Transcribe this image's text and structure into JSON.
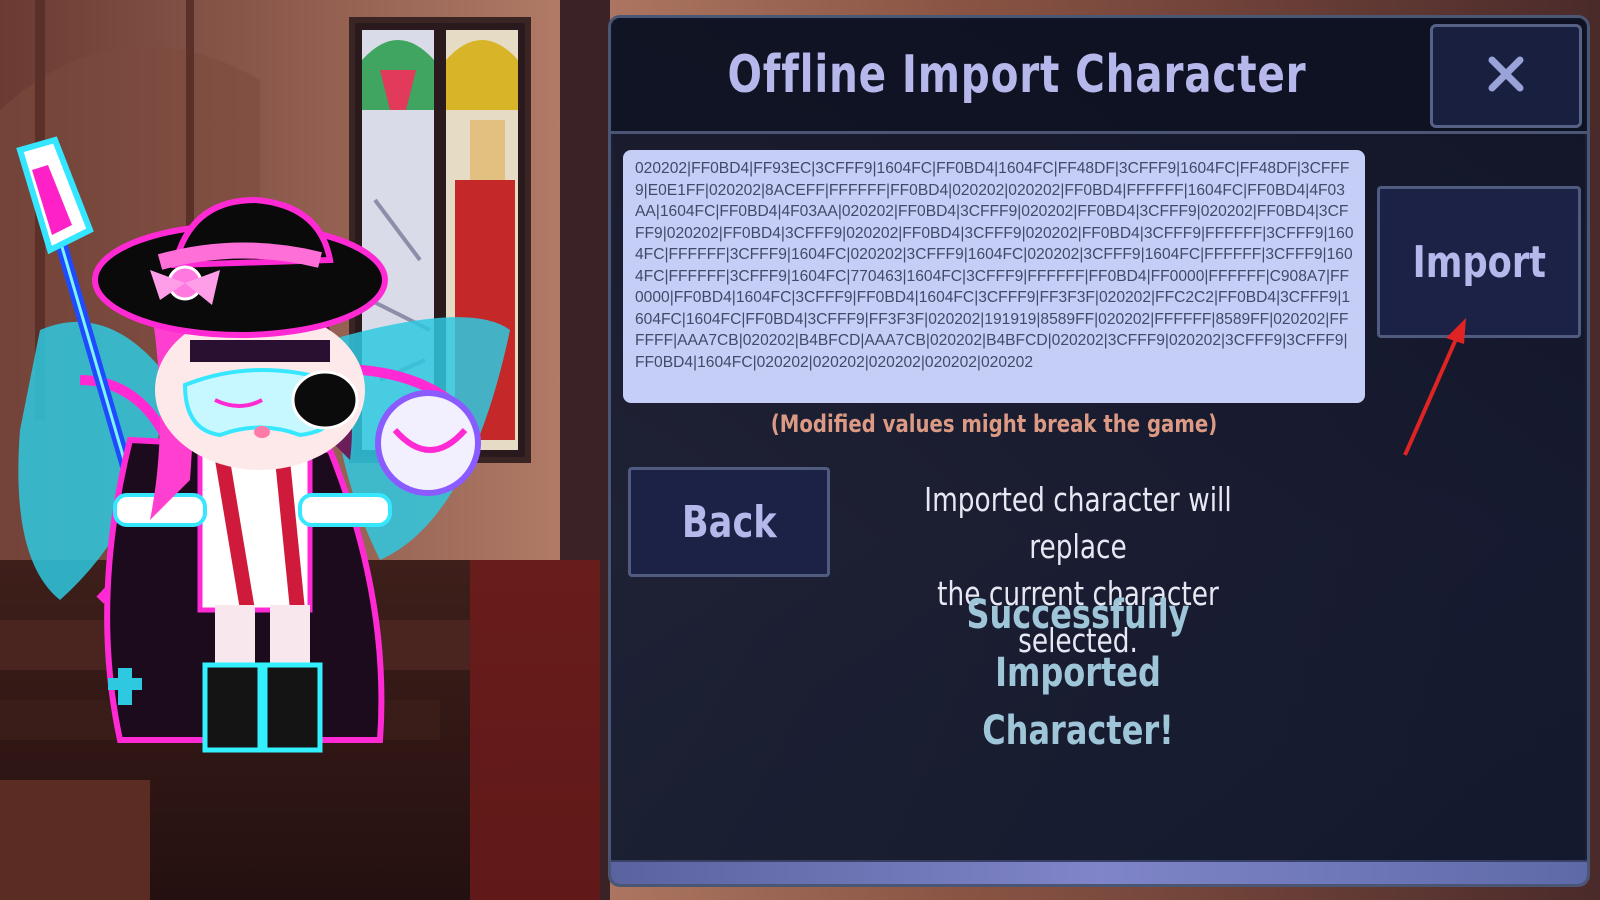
{
  "dialog": {
    "title": "Offline Import Character",
    "close_glyph": "X",
    "code_value": "020202|FF0BD4|FF93EC|3CFFF9|1604FC|FF0BD4|1604FC|FF48DF|3CFFF9|1604FC|FF48DF|3CFFF9|E0E1FF|020202|8ACEFF|FFFFFF|FF0BD4|020202|020202|FF0BD4|FFFFFF|1604FC|FF0BD4|4F03AA|1604FC|FF0BD4|4F03AA|020202|FF0BD4|3CFFF9|020202|FF0BD4|3CFFF9|020202|FF0BD4|3CFFF9|020202|FF0BD4|3CFFF9|020202|FF0BD4|3CFFF9|020202|FF0BD4|3CFFF9|FFFFFF|3CFFF9|1604FC|FFFFFF|3CFFF9|1604FC|020202|3CFFF9|1604FC|020202|3CFFF9|1604FC|FFFFFF|3CFFF9|1604FC|FFFFFF|3CFFF9|1604FC|770463|1604FC|3CFFF9|FFFFFF|FF0BD4|FF0000|FFFFFF|C908A7|FF0000|FF0BD4|1604FC|3CFFF9|FF0BD4|1604FC|3CFFF9|FF3F3F|020202|FFC2C2|FF0BD4|3CFFF9|1604FC|1604FC|FF0BD4|3CFFF9|FF3F3F|020202|191919|8589FF|020202|FFFFFF|8589FF|020202|FFFFFF|AAA7CB|020202|B4BFCD|AAA7CB|020202|B4BFCD|020202|3CFFF9|020202|3CFFF9|3CFFF9|FF0BD4|1604FC|020202|020202|020202|020202|020202",
    "warning": "(Modified values might break the game)",
    "import_label": "Import",
    "back_label": "Back",
    "replace_note_line1": "Imported character will replace",
    "replace_note_line2": "the current character selected.",
    "success_line1": "Successfully Imported",
    "success_line2": "Character!"
  },
  "colors": {
    "title_text": "#b6b7ea",
    "panel_bg": "#0f1630",
    "code_bg": "#c5cef6",
    "warning_text": "#dc9a84",
    "success_text": "#9fc5d8",
    "annotation_arrow": "#e02424"
  },
  "icons": {
    "close": "close-icon",
    "arrow": "red-annotation-arrow"
  }
}
